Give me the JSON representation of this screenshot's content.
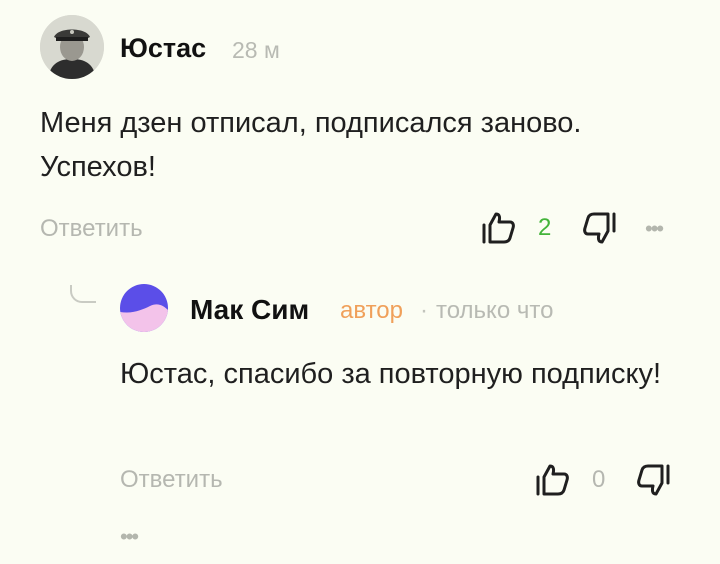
{
  "comment": {
    "author": "Юстас",
    "time": "28 м",
    "text": "Меня дзен отписал, подписался заново. Успехов!",
    "reply_label": "Ответить",
    "like_count": "2",
    "more_label": "•••"
  },
  "reply": {
    "author": "Мак Сим",
    "badge": "автор",
    "separator": "·",
    "time": "только что",
    "text": "Юстас, спасибо за повторную подписку!",
    "reply_label": "Ответить",
    "like_count": "0",
    "more_label": "•••"
  },
  "colors": {
    "background": "#fbfdf3",
    "like_active": "#43b43a",
    "author_badge": "#f0a05a",
    "avatar_purple": "#5b4ee8",
    "avatar_pink": "#f3c3ea"
  },
  "icons": {
    "like": "thumbs-up-icon",
    "dislike": "thumbs-down-icon",
    "more": "more-dots-icon"
  }
}
